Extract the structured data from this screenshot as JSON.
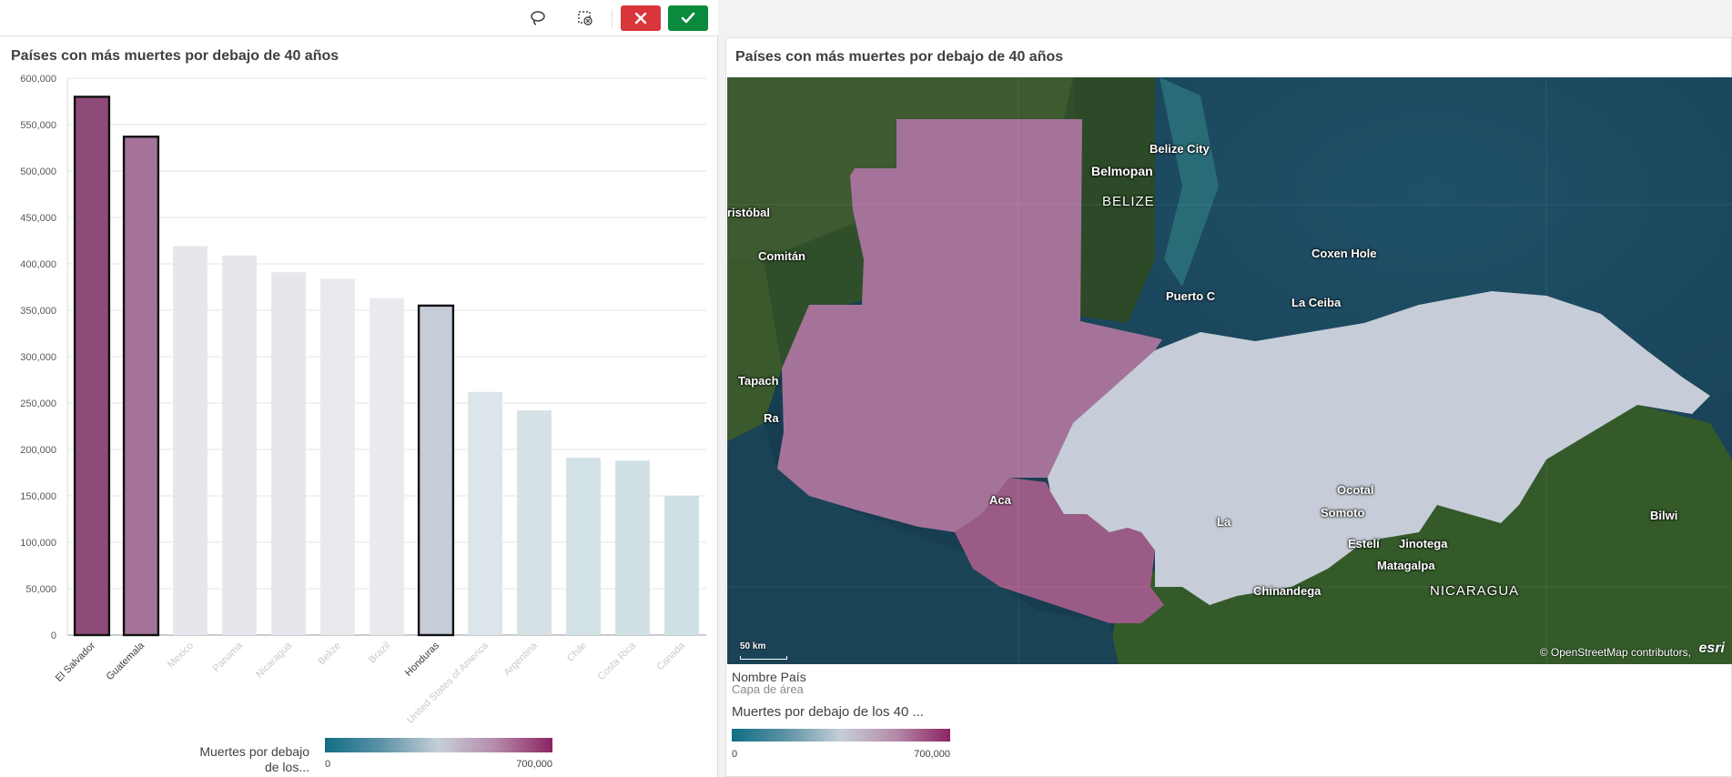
{
  "toolbar": {
    "lasso_icon": "lasso-icon",
    "clear_icon": "clear-selection-icon",
    "cancel_icon": "close-icon",
    "confirm_icon": "check-icon",
    "cancel_color": "#d9363b",
    "confirm_color": "#0a8a3c"
  },
  "bar_chart": {
    "title": "Países con más muertes por debajo de 40 años",
    "legend": {
      "label": "Muertes por debajo de los...",
      "min": "0",
      "max": "700,000"
    }
  },
  "chart_data": {
    "type": "bar",
    "title": "Países con más muertes por debajo de 40 años",
    "xlabel": "",
    "ylabel": "",
    "ylim": [
      0,
      600000
    ],
    "yticks": [
      0,
      50000,
      100000,
      150000,
      200000,
      250000,
      300000,
      350000,
      400000,
      450000,
      500000,
      550000,
      600000
    ],
    "ytick_labels": [
      "0",
      "50,000",
      "100,000",
      "150,000",
      "200,000",
      "250,000",
      "300,000",
      "350,000",
      "400,000",
      "450,000",
      "500,000",
      "550,000",
      "600,000"
    ],
    "grid": true,
    "categories": [
      "El Salvador",
      "Guatemala",
      "Mexico",
      "Panama",
      "Nicaragua",
      "Belize",
      "Brazil",
      "Honduras",
      "United States of America",
      "Argentina",
      "Chile",
      "Costa Rica",
      "Canada"
    ],
    "values": [
      580000,
      537000,
      419000,
      409000,
      391000,
      384000,
      363000,
      355000,
      262000,
      242000,
      191000,
      188000,
      150000
    ],
    "selected": [
      true,
      true,
      false,
      false,
      false,
      false,
      false,
      true,
      false,
      false,
      false,
      false,
      false
    ],
    "colors": [
      "#8e4b7a",
      "#a5739a",
      "#e9e5ec",
      "#e9e5ec",
      "#e9e5ec",
      "#ebe8ee",
      "#ebe9ee",
      "#c6cdd8",
      "#dce5ea",
      "#d6e1e6",
      "#d2e1e6",
      "#d0e0e5",
      "#cfe0e5"
    ],
    "color_scale": {
      "min": 0,
      "max": 700000,
      "from": "#116e86",
      "mid": "#c6cfd8",
      "to": "#8b2463"
    }
  },
  "map": {
    "title": "Países con más muertes por debajo de 40 años",
    "labels": [
      "Belize City",
      "Belmopan",
      "BELIZE",
      "ristóbal",
      "Comitán",
      "Coxen Hole",
      "Puerto C",
      "La Ceiba",
      "Tapach",
      "Ra",
      "Aca",
      "La",
      "Ocotal",
      "Somoto",
      "Estelí",
      "Jinotega",
      "Matagalpa",
      "Bilwi",
      "Chinandega",
      "NICARAGUA"
    ],
    "scale": "50 km",
    "attribution": "© OpenStreetMap contributors,",
    "logo": "esri",
    "country_colors": {
      "Guatemala": "#a5739a",
      "El Salvador": "#9a5c86",
      "Honduras": "#c6cdd8"
    },
    "legend": {
      "dimension": "Nombre País",
      "layer": "Capa de área",
      "measure": "Muertes por debajo de los 40 ...",
      "min": "0",
      "max": "700,000"
    }
  }
}
